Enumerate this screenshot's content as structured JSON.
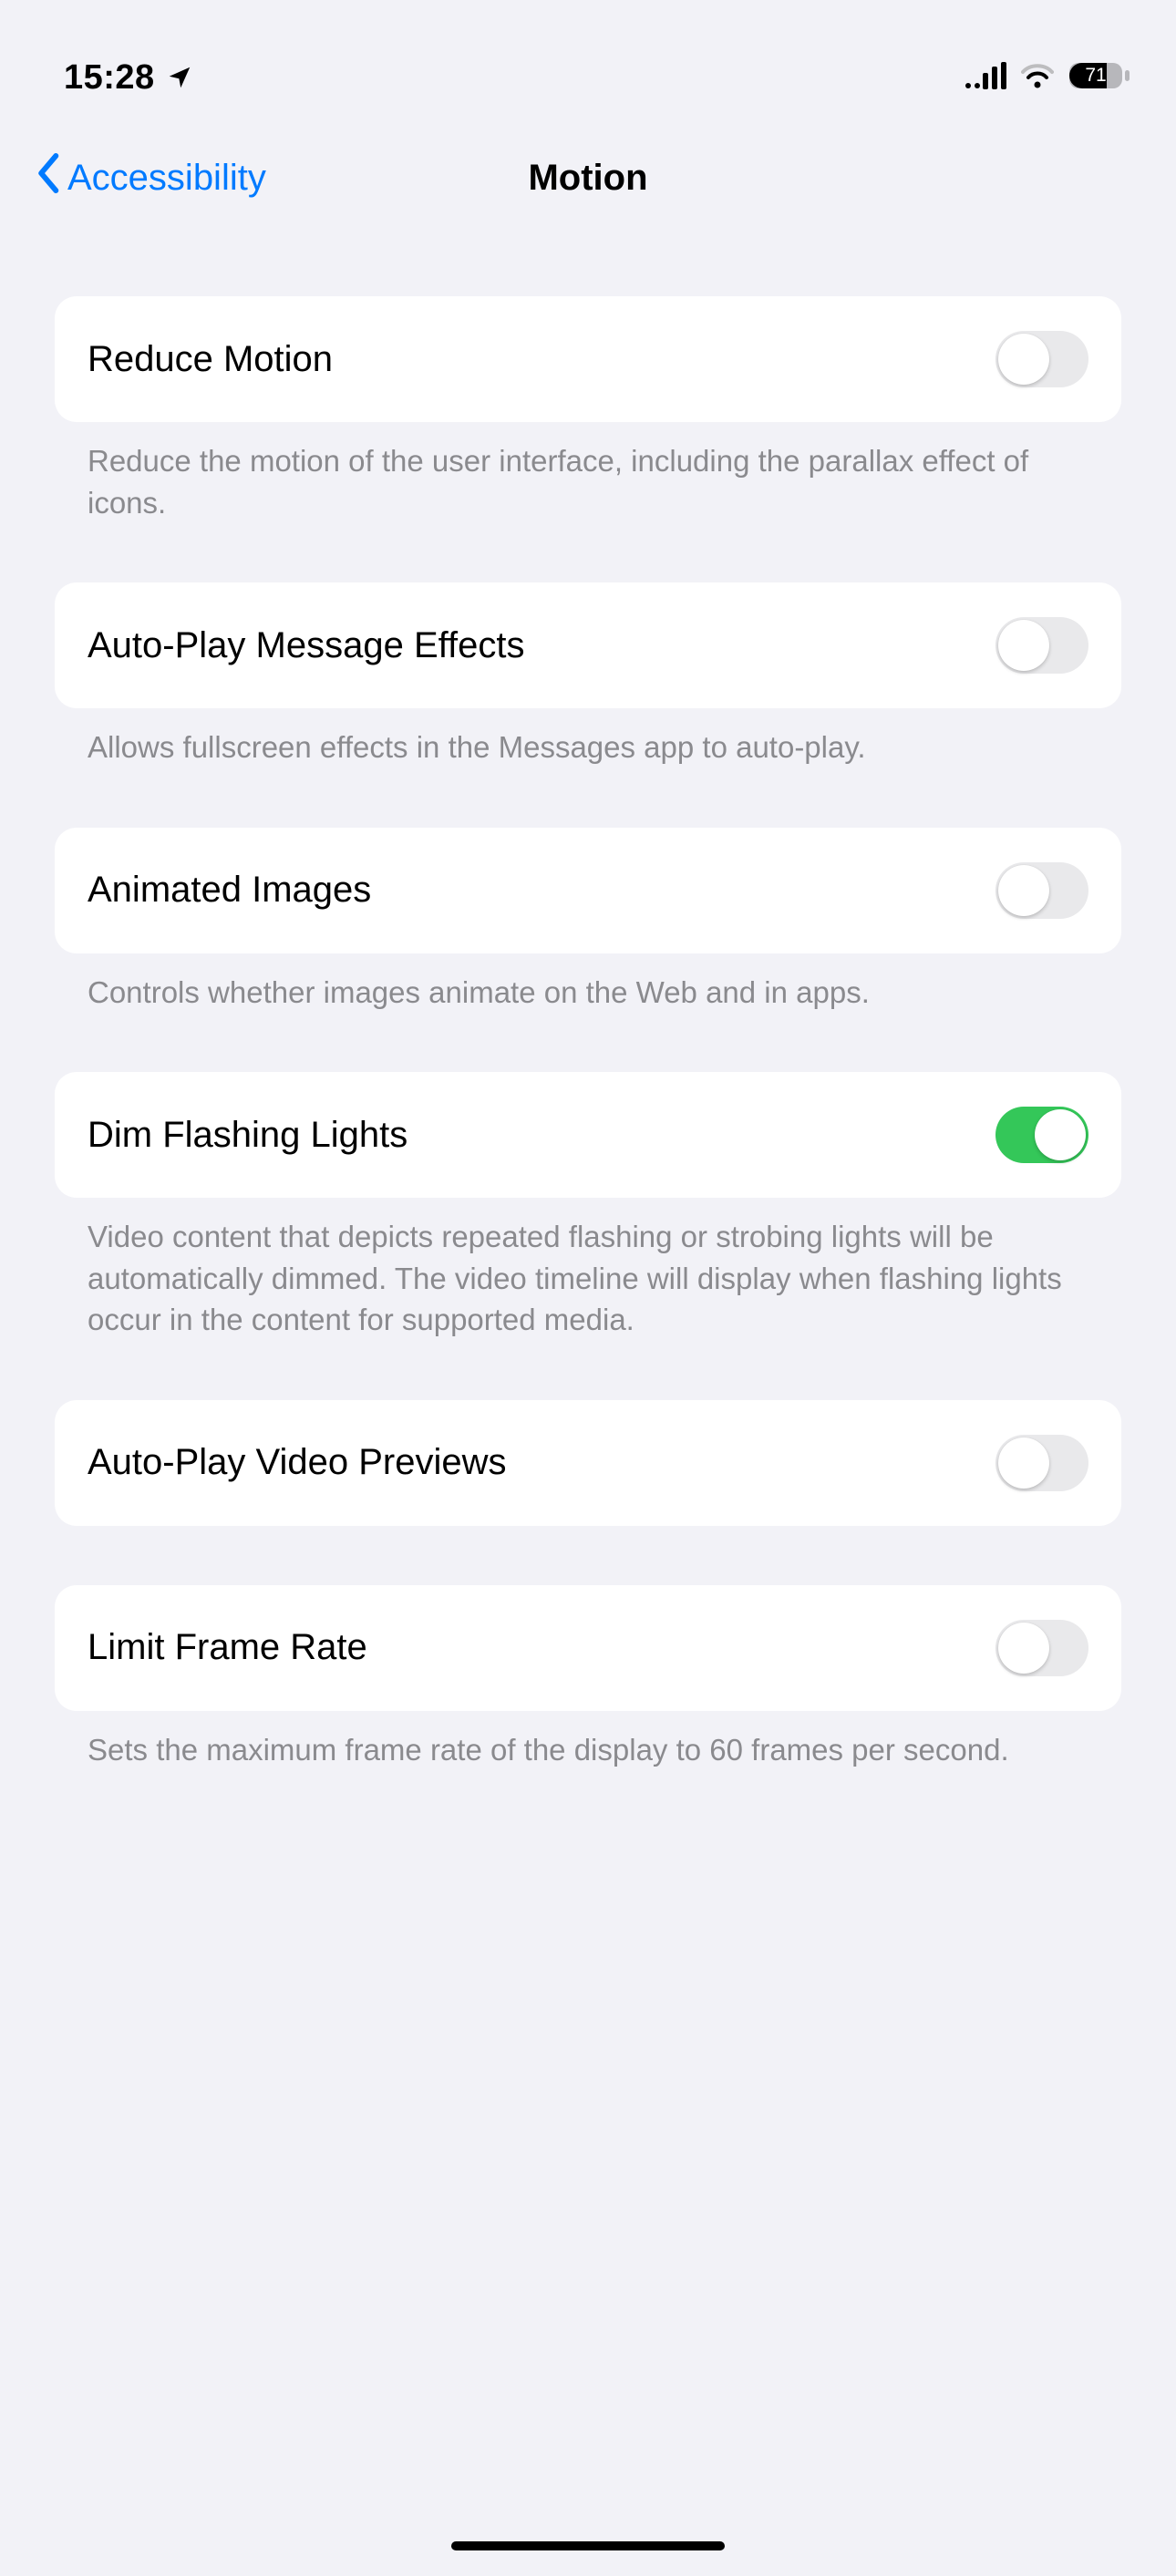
{
  "status": {
    "time": "15:28",
    "battery_pct": "71"
  },
  "nav": {
    "back_label": "Accessibility",
    "title": "Motion"
  },
  "settings": [
    {
      "label": "Reduce Motion",
      "on": false,
      "footer": "Reduce the motion of the user interface, including the parallax effect of icons."
    },
    {
      "label": "Auto-Play Message Effects",
      "on": false,
      "footer": "Allows fullscreen effects in the Messages app to auto-play."
    },
    {
      "label": "Animated Images",
      "on": false,
      "footer": "Controls whether images animate on the Web and in apps."
    },
    {
      "label": "Dim Flashing Lights",
      "on": true,
      "footer": "Video content that depicts repeated flashing or strobing lights will be automatically dimmed. The video timeline will display when flashing lights occur in the content for supported media."
    },
    {
      "label": "Auto-Play Video Previews",
      "on": false,
      "footer": ""
    },
    {
      "label": "Limit Frame Rate",
      "on": false,
      "footer": "Sets the maximum frame rate of the display to 60 frames per second."
    }
  ]
}
